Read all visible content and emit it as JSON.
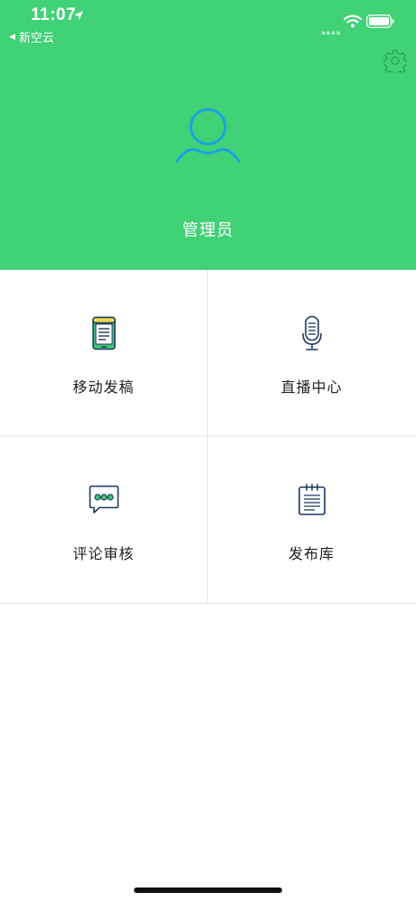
{
  "status_bar": {
    "time": "11:07"
  },
  "back": {
    "label": "新空云"
  },
  "profile": {
    "name": "管理员"
  },
  "menu": [
    {
      "label": "移动发稿",
      "icon": "mobile-document-icon"
    },
    {
      "label": "直播中心",
      "icon": "microphone-icon"
    },
    {
      "label": "评论审核",
      "icon": "chat-bubble-icon"
    },
    {
      "label": "发布库",
      "icon": "notepad-icon"
    }
  ],
  "colors": {
    "header": "#41d176",
    "avatar": "#1aa3e0",
    "icon_navy": "#1f3a60",
    "divider": "#e5e5e5"
  }
}
